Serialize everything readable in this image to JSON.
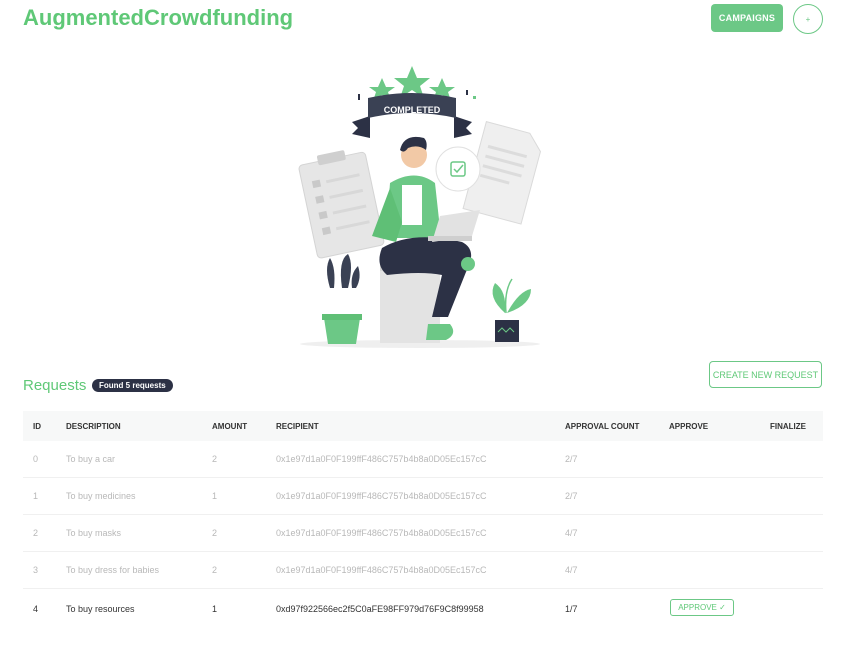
{
  "header": {
    "brand": "AugmentedCrowdfunding",
    "campaigns_label": "CAMPAIGNS",
    "menu_button_label": "+"
  },
  "hero": {
    "ribbon_text": "COMPLETED"
  },
  "requests": {
    "title": "Requests",
    "badge": "Found 5 requests",
    "create_label": "CREATE NEW REQUEST",
    "columns": [
      "ID",
      "DESCRIPTION",
      "AMOUNT",
      "RECIPIENT",
      "APPROVAL COUNT",
      "APPROVE",
      "FINALIZE"
    ],
    "rows": [
      {
        "id": "0",
        "description": "To buy a car",
        "amount": "2",
        "recipient": "0x1e97d1a0F0F199ffF486C757b4b8a0D05Ec157cC",
        "approval_count": "2/7"
      },
      {
        "id": "1",
        "description": "To buy medicines",
        "amount": "1",
        "recipient": "0x1e97d1a0F0F199ffF486C757b4b8a0D05Ec157cC",
        "approval_count": "2/7"
      },
      {
        "id": "2",
        "description": "To buy masks",
        "amount": "2",
        "recipient": "0x1e97d1a0F0F199ffF486C757b4b8a0D05Ec157cC",
        "approval_count": "4/7"
      },
      {
        "id": "3",
        "description": "To buy dress for babies",
        "amount": "2",
        "recipient": "0x1e97d1a0F0F199ffF486C757b4b8a0D05Ec157cC",
        "approval_count": "4/7"
      },
      {
        "id": "4",
        "description": "To buy resources",
        "amount": "1",
        "recipient": "0xd97f922566ec2f5C0aFE98FF979d76F9C8f99958",
        "approval_count": "1/7",
        "approve_label": "APPROVE ✓"
      }
    ]
  },
  "colors": {
    "brand_green": "#5fc877",
    "badge_dark": "#2c3145"
  }
}
